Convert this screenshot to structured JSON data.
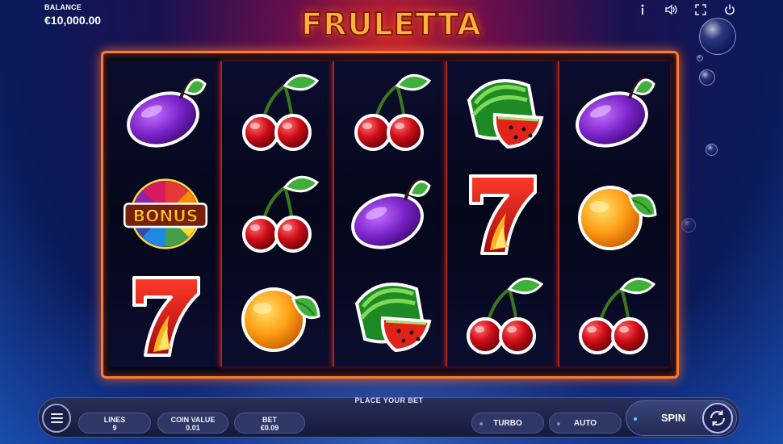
{
  "balance": {
    "label": "BALANCE",
    "value": "€10,000.00"
  },
  "logo": {
    "text": "FRULETTA"
  },
  "top_icons": [
    "info-icon",
    "sound-icon",
    "fullscreen-icon",
    "power-icon"
  ],
  "reels": [
    [
      "plum",
      "bonus",
      "seven"
    ],
    [
      "cherry",
      "cherry",
      "orange"
    ],
    [
      "cherry",
      "plum",
      "watermelon"
    ],
    [
      "watermelon",
      "seven",
      "cherry"
    ],
    [
      "plum",
      "orange",
      "cherry"
    ]
  ],
  "bonus_label": "BONUS",
  "controls": {
    "place_bet": "PLACE YOUR BET",
    "lines": {
      "label": "LINES",
      "value": "9"
    },
    "coin_value": {
      "label": "COIN VALUE",
      "value": "0.01"
    },
    "bet": {
      "label": "BET",
      "value": "€0.09"
    },
    "turbo": "TURBO",
    "auto": "AUTO",
    "spin": "SPIN"
  },
  "colors": {
    "frame": "#ff7a2a",
    "divider": "#b0201c",
    "accent": "#ffb23a"
  }
}
